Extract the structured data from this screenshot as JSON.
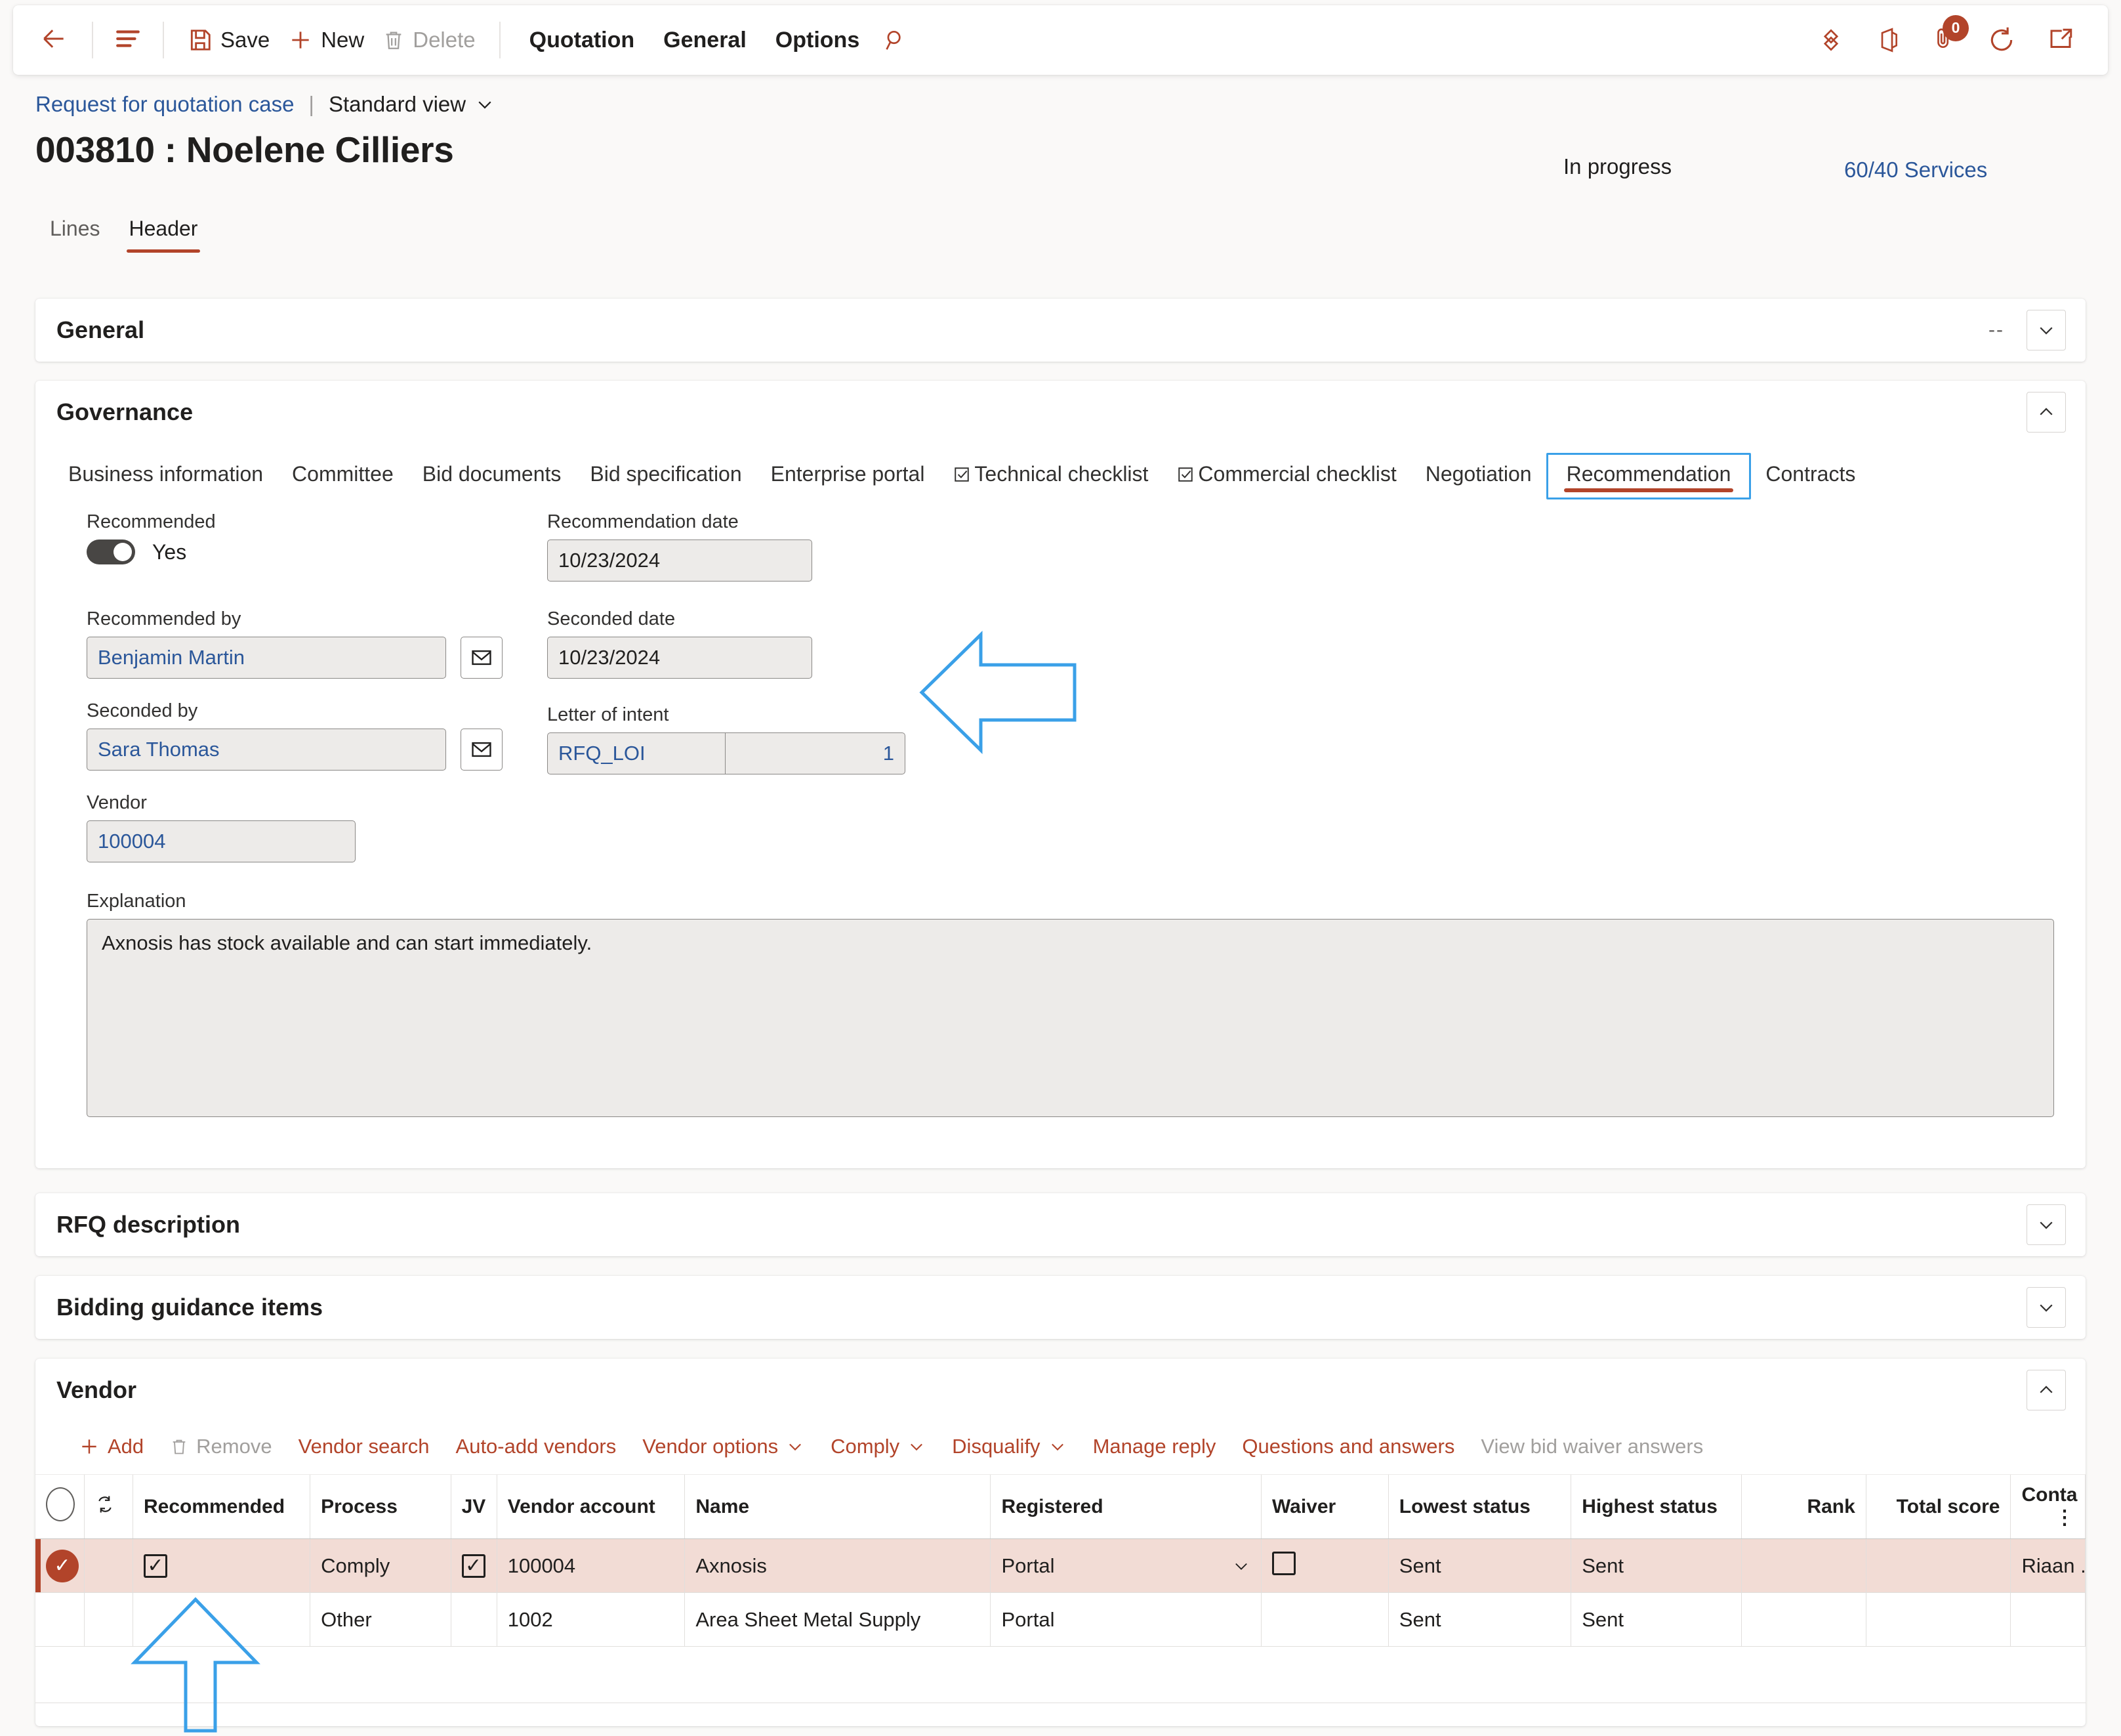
{
  "commandbar": {
    "back_label": "Back",
    "nav_label": "Show navigation",
    "save_label": "Save",
    "new_label": "New",
    "delete_label": "Delete",
    "quotation_label": "Quotation",
    "general_label": "General",
    "options_label": "Options",
    "search_label": "Search",
    "attachment_badge": "0",
    "accent_color": "#b2442a"
  },
  "breadcrumb": {
    "parent": "Request for quotation case",
    "divider": "|",
    "view": "Standard view"
  },
  "header": {
    "title": "003810 : Noelene Cilliers",
    "status": "In progress",
    "legal_entity": "60/40 Services",
    "tabs": [
      {
        "label": "Lines",
        "active": false
      },
      {
        "label": "Header",
        "active": true
      }
    ]
  },
  "sections": {
    "general": {
      "title": "General",
      "summary": "--",
      "expanded": false
    },
    "governance": {
      "title": "Governance",
      "expanded": true
    },
    "rfq_description": {
      "title": "RFQ description",
      "expanded": false
    },
    "bidding_guidance": {
      "title": "Bidding guidance items",
      "expanded": false
    },
    "vendor": {
      "title": "Vendor",
      "expanded": true
    }
  },
  "governance_tabs": [
    {
      "label": "Business information",
      "active": false,
      "has_check_icon": false
    },
    {
      "label": "Committee",
      "active": false,
      "has_check_icon": false
    },
    {
      "label": "Bid documents",
      "active": false,
      "has_check_icon": false
    },
    {
      "label": "Bid specification",
      "active": false,
      "has_check_icon": false
    },
    {
      "label": "Enterprise portal",
      "active": false,
      "has_check_icon": false
    },
    {
      "label": "Technical checklist",
      "active": false,
      "has_check_icon": true
    },
    {
      "label": "Commercial checklist",
      "active": false,
      "has_check_icon": true
    },
    {
      "label": "Negotiation",
      "active": false,
      "has_check_icon": false
    },
    {
      "label": "Recommendation",
      "active": true,
      "has_check_icon": false
    },
    {
      "label": "Contracts",
      "active": false,
      "has_check_icon": false
    }
  ],
  "recommendation_form": {
    "recommended_label": "Recommended",
    "recommended_value": "Yes",
    "recommended_by_label": "Recommended by",
    "recommended_by_value": "Benjamin Martin",
    "seconded_by_label": "Seconded by",
    "seconded_by_value": "Sara Thomas",
    "vendor_label": "Vendor",
    "vendor_value": "100004",
    "recommendation_date_label": "Recommendation date",
    "recommendation_date_value": "10/23/2024",
    "seconded_date_label": "Seconded date",
    "seconded_date_value": "10/23/2024",
    "letter_of_intent_label": "Letter of intent",
    "letter_of_intent_value": "RFQ_LOI",
    "letter_of_intent_number": "1",
    "explanation_label": "Explanation",
    "explanation_value": "Axnosis has stock available and can start immediately."
  },
  "vendor_toolbar": [
    {
      "label": "Add",
      "icon": "plus-icon",
      "disabled": false
    },
    {
      "label": "Remove",
      "icon": "trash-icon",
      "disabled": true
    },
    {
      "label": "Vendor search",
      "icon": "",
      "disabled": false
    },
    {
      "label": "Auto-add vendors",
      "icon": "",
      "disabled": false
    },
    {
      "label": "Vendor options",
      "icon": "chevron-down-icon",
      "disabled": false
    },
    {
      "label": "Comply",
      "icon": "chevron-down-icon",
      "disabled": false
    },
    {
      "label": "Disqualify",
      "icon": "chevron-down-icon",
      "disabled": false
    },
    {
      "label": "Manage reply",
      "icon": "",
      "disabled": false
    },
    {
      "label": "Questions and answers",
      "icon": "",
      "disabled": false
    },
    {
      "label": "View bid waiver answers",
      "icon": "",
      "disabled": true
    }
  ],
  "vendor_grid": {
    "columns": [
      "",
      "",
      "Recommended",
      "Process",
      "JV",
      "Vendor account",
      "Name",
      "Registered",
      "Waiver",
      "Lowest status",
      "Highest status",
      "Rank",
      "Total score",
      "Conta"
    ],
    "rows": [
      {
        "selected": true,
        "recommended_checked": true,
        "process": "Comply",
        "jv_checked": true,
        "vendor_account": "100004",
        "name": "Axnosis",
        "registered": "Portal",
        "registered_has_dropdown": true,
        "waiver_checked": false,
        "waiver_visible": true,
        "lowest_status": "Sent",
        "highest_status": "Sent",
        "rank": "",
        "total_score": "",
        "contact": "Riaan ..."
      },
      {
        "selected": false,
        "recommended_checked": false,
        "process": "Other",
        "jv_checked": false,
        "vendor_account": "1002",
        "name": "Area Sheet Metal Supply",
        "registered": "Portal",
        "registered_has_dropdown": false,
        "waiver_checked": false,
        "waiver_visible": false,
        "lowest_status": "Sent",
        "highest_status": "Sent",
        "rank": "",
        "total_score": "",
        "contact": ""
      }
    ]
  },
  "annotations": [
    {
      "name": "arrow-left-recommendation",
      "direction": "left",
      "color": "#3aa0e8"
    },
    {
      "name": "arrow-up-recommended-checkbox",
      "direction": "up",
      "color": "#3aa0e8"
    }
  ]
}
